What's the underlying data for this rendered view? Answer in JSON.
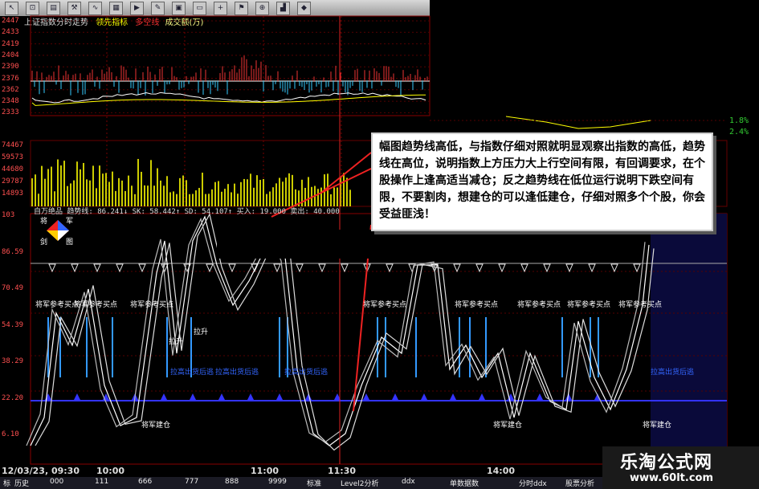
{
  "toolbar": {
    "icons": [
      "arrow-icon",
      "toggle-icon",
      "bar-icon",
      "tool-icon",
      "trend-icon",
      "grid-icon",
      "play-icon",
      "pencil-icon",
      "panel-icon",
      "window-icon",
      "crosshair-icon",
      "flag-icon",
      "zoom-icon",
      "chart-icon",
      "diamond-icon"
    ]
  },
  "top_chart": {
    "title": "上证指数分时走势",
    "indicator_label": "领先指标",
    "legend_a": "多空线",
    "legend_b": "成交额(万)",
    "price_ticks": [
      "2447",
      "2433",
      "2419",
      "2404",
      "2390",
      "2376",
      "2362",
      "2348",
      "2333"
    ],
    "volume_ticks": [
      "74467",
      "59573",
      "44680",
      "29787",
      "14893"
    ],
    "pct_labels": [
      "1.8%",
      "2.4%"
    ]
  },
  "indicator": {
    "header": "自万绝品  趋势线:  86.241↓ SK: 58.442↑ SD: 54.107↑ 买入: 19.000  卖出: 40.000",
    "y_ticks": [
      "103",
      "86.59",
      "70.49",
      "54.39",
      "38.29",
      "22.20",
      "6.10"
    ],
    "logo_chars": [
      "将",
      "军",
      "剑",
      "图"
    ],
    "tags": {
      "buy_ref": "将军参考买点",
      "sell_ref": "拉高出货后逃",
      "build": "将军建仓",
      "pull_up": "拉升",
      "pull_up2": "拉升"
    }
  },
  "callout_text": "幅图趋势线高低，与指数仔细对照就明显观察出指数的高低，趋势线在高位，说明指数上方压力大上行空间有限，有回调要求，在个股操作上逢高适当减仓；反之趋势线在低位运行说明下跌空间有限，不要割肉，想建仓的可以逢低建仓，仔细对照多个个股，你会受益匪浅！",
  "time_axis": [
    "12/03/23, 09:30",
    "10:00",
    "11:00",
    "11:30",
    "14:00"
  ],
  "bottom_bar": [
    "标",
    "历史",
    "000",
    "111",
    "666",
    "777",
    "888",
    "9999",
    "标准",
    "Level2分析",
    "ddx",
    "单数据数",
    "分时ddx",
    "股票分析"
  ],
  "brand": {
    "name": "乐淘公式网",
    "url": "www.60lt.com"
  }
}
